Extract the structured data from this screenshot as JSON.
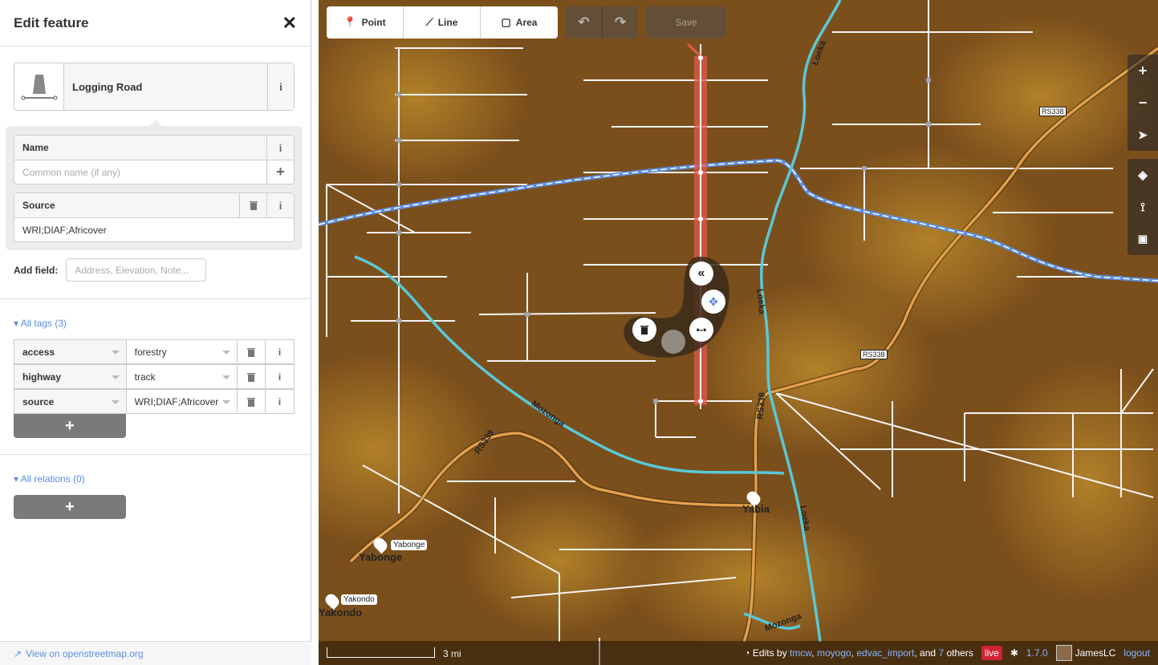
{
  "sidebar": {
    "title": "Edit feature",
    "close_icon": "✕",
    "preset": {
      "name": "Logging Road",
      "info": "i"
    },
    "fields": {
      "name": {
        "label": "Name",
        "placeholder": "Common name (if any)",
        "info": "i",
        "add": "+"
      },
      "source": {
        "label": "Source",
        "value": "WRI;DIAF;Africover",
        "info": "i"
      }
    },
    "add_field": {
      "label": "Add field:",
      "placeholder": "Address, Elevation, Note..."
    },
    "all_tags": "All tags (3)",
    "tags": [
      {
        "key": "access",
        "value": "forestry"
      },
      {
        "key": "highway",
        "value": "track"
      },
      {
        "key": "source",
        "value": "WRI;DIAF;Africover"
      }
    ],
    "add_symbol": "+",
    "all_relations": "All relations (0)",
    "footer_link": "View on openstreetmap.org"
  },
  "toolbar": {
    "point": "Point",
    "line": "Line",
    "area": "Area",
    "save": "Save"
  },
  "map": {
    "labels": {
      "mozonga": "Mozonga",
      "mozonga2": "Mozonga",
      "loeka1": "Loeka",
      "loeka2": "Loeka",
      "loeka3": "Loeka",
      "rs339": "RS339",
      "rs338_a": "RS338",
      "rs338_b": "RS338",
      "rs338_c": "RS338",
      "yabonge_poi": "Yabonge",
      "yabonge_town": "Yabonge",
      "yakondo_poi": "Yakondo",
      "yakondo_town": "Yakondo",
      "yabia": "Yabia"
    },
    "scale_label": "3 mi",
    "attribution": {
      "prefix": "Edits by",
      "users": [
        "tmcw",
        "moyogo",
        "edvac_import"
      ],
      "and": ", and",
      "others_count": "7",
      "others": "others"
    },
    "live_badge": "live",
    "version": "1.7.0",
    "username": "JamesLC",
    "logout": "logout"
  }
}
